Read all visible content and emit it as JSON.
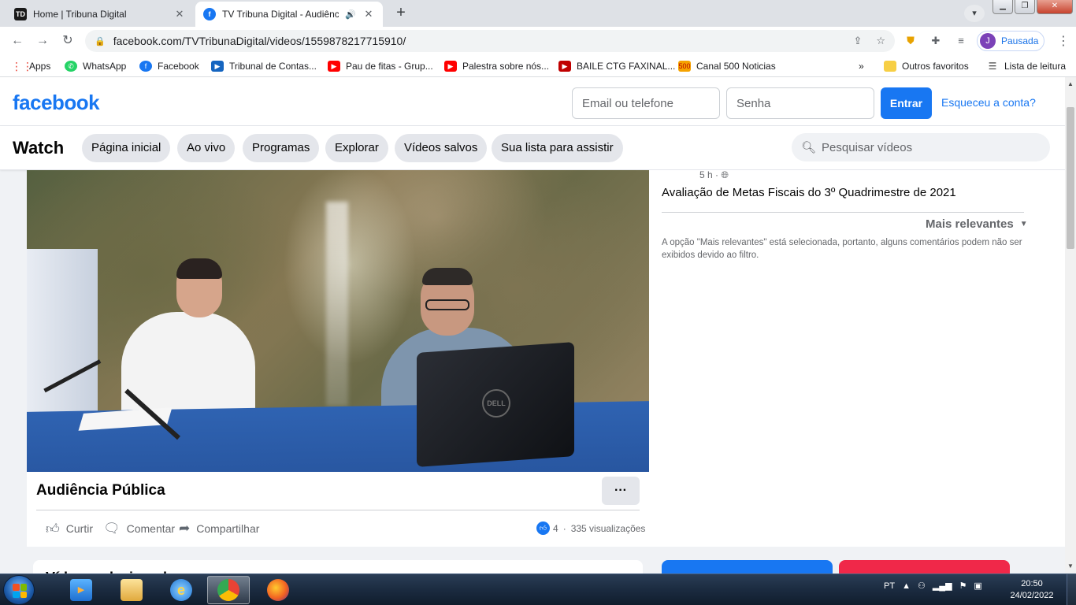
{
  "browser": {
    "tabs": [
      {
        "title": "Home | Tribuna Digital",
        "favicon_text": "TD",
        "favicon_color": "#1a1a1a"
      },
      {
        "title": "TV Tribuna Digital - Audiência",
        "favicon_text": "f",
        "favicon_color": "#1877f2"
      }
    ],
    "url_domain": "facebook.com",
    "url_path": "/TVTribunaDigital/videos/1559878217715910/",
    "profile_initial": "J",
    "profile_status": "Pausada",
    "bookmarks": [
      {
        "label": "Apps",
        "color": "#e94235"
      },
      {
        "label": "WhatsApp",
        "color": "#25d366"
      },
      {
        "label": "Facebook",
        "color": "#1877f2"
      },
      {
        "label": "Tribunal de Contas...",
        "color": "#1565c0"
      },
      {
        "label": "Pau de fitas - Grup...",
        "color": "#ff0000"
      },
      {
        "label": "Palestra sobre nós...",
        "color": "#ff0000"
      },
      {
        "label": "BAILE CTG FAXINAL...",
        "color": "#c00000"
      },
      {
        "label": "Canal 500 Noticias",
        "color": "#f5a300"
      }
    ],
    "bookmarks_overflow": "»",
    "other_favorites": "Outros favoritos",
    "reading_list": "Lista de leitura"
  },
  "fb": {
    "logo": "facebook",
    "email_placeholder": "Email ou telefone",
    "password_placeholder": "Senha",
    "login_button": "Entrar",
    "forgot_link": "Esqueceu a conta?"
  },
  "watch": {
    "title": "Watch",
    "nav": [
      "Página inicial",
      "Ao vivo",
      "Programas",
      "Explorar",
      "Vídeos salvos",
      "Sua lista para assistir"
    ],
    "search_placeholder": "Pesquisar vídeos"
  },
  "video": {
    "title": "Audiência Pública",
    "more": "···",
    "actions": {
      "like": "Curtir",
      "comment": "Comentar",
      "share": "Compartilhar"
    },
    "likes": "4",
    "views": "335 visualizações",
    "laptop_brand": "DELL"
  },
  "side": {
    "time": "5 h ·",
    "description": "Avaliação de Metas Fiscais do 3º Quadrimestre de 2021",
    "sort_label": "Mais relevantes",
    "filter_note": "A opção \"Mais relevantes\" está selecionada, portanto, alguns comentários podem não ser exibidos devido ao filtro."
  },
  "lower": {
    "peek_title": "Vídeos relacionados"
  },
  "taskbar": {
    "language": "PT",
    "time": "20:50",
    "date": "24/02/2022"
  }
}
